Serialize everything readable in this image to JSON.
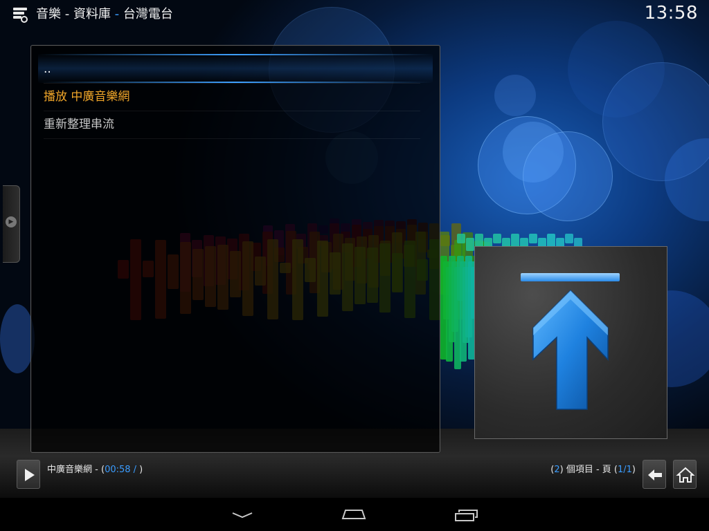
{
  "header": {
    "section": "音樂",
    "separator1": " - ",
    "library": "資料庫",
    "separator2": " - ",
    "folder": "台灣電台",
    "clock": "13:58"
  },
  "list": {
    "items": [
      {
        "label": "..",
        "state": "focused"
      },
      {
        "label": "播放 中廣音樂網",
        "state": "playing"
      },
      {
        "label": "重新整理串流",
        "state": "normal"
      }
    ]
  },
  "thumbnail": {
    "icon": "up-arrow-icon"
  },
  "footer": {
    "now_playing_title": "中廣音樂網",
    "now_playing_sep": " - ",
    "paren_open": "(",
    "time": "00:58 /",
    "paren_close": " )",
    "count_open": "(",
    "count_value": "2",
    "count_close": ")",
    "count_label": " 個項目 - 頁 ",
    "page_open": "(",
    "page_value": "1/1",
    "page_close": ")"
  },
  "icons": {
    "play": "play-icon",
    "back": "back-arrow-icon",
    "home": "home-icon",
    "nav_back": "android-back-icon",
    "nav_home": "android-home-icon",
    "nav_recents": "android-recents-icon"
  },
  "colors": {
    "accent": "#3a9cff",
    "playing": "#f0a629"
  }
}
